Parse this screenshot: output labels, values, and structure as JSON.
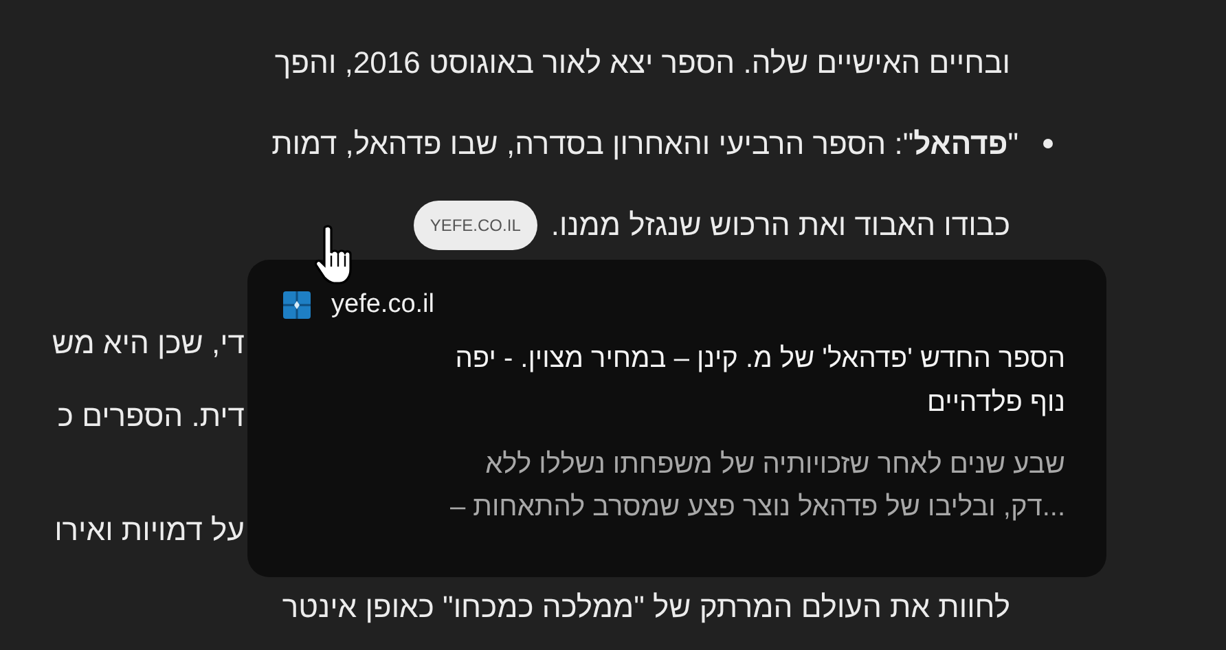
{
  "article": {
    "lines": [
      {
        "kind": "text",
        "text": "ובחיים האישיים שלה. הספר יצא לאור באוגוסט 2016, והפך"
      },
      {
        "kind": "bullet",
        "text": "\"**פדהאל**\": הספר הרביעי והאחרון בסדרה, שבו פדהאל, דמות"
      },
      {
        "kind": "text-with-chip",
        "text": "כבודו האבוד ואת הרכוש שנגזל ממנו.",
        "chip": "YEFE.CO.IL"
      },
      {
        "kind": "gap"
      },
      {
        "kind": "fragment",
        "text": "די, שכן היא מש"
      },
      {
        "kind": "fragment",
        "text": "דית. הספרים כ"
      },
      {
        "kind": "gap"
      },
      {
        "kind": "fragment",
        "text": "על דמויות ואירו"
      },
      {
        "kind": "text",
        "text": "לחוות את העולם המרתק של \"ממלכה כמכחו\" כאופן אינטר"
      }
    ]
  },
  "link_preview": {
    "site": "yefe.co.il",
    "title": "הספר החדש 'פדהאל' של מ. קינן – במחיר מצוין. - יפה\nנוף פלדהיים",
    "description": "שבע שנים לאחר שזכויותיה של משפחתו נשללו ללא\n...דק, ובליבו של פדהאל נוצר פצע שמסרב להתאחות –"
  }
}
